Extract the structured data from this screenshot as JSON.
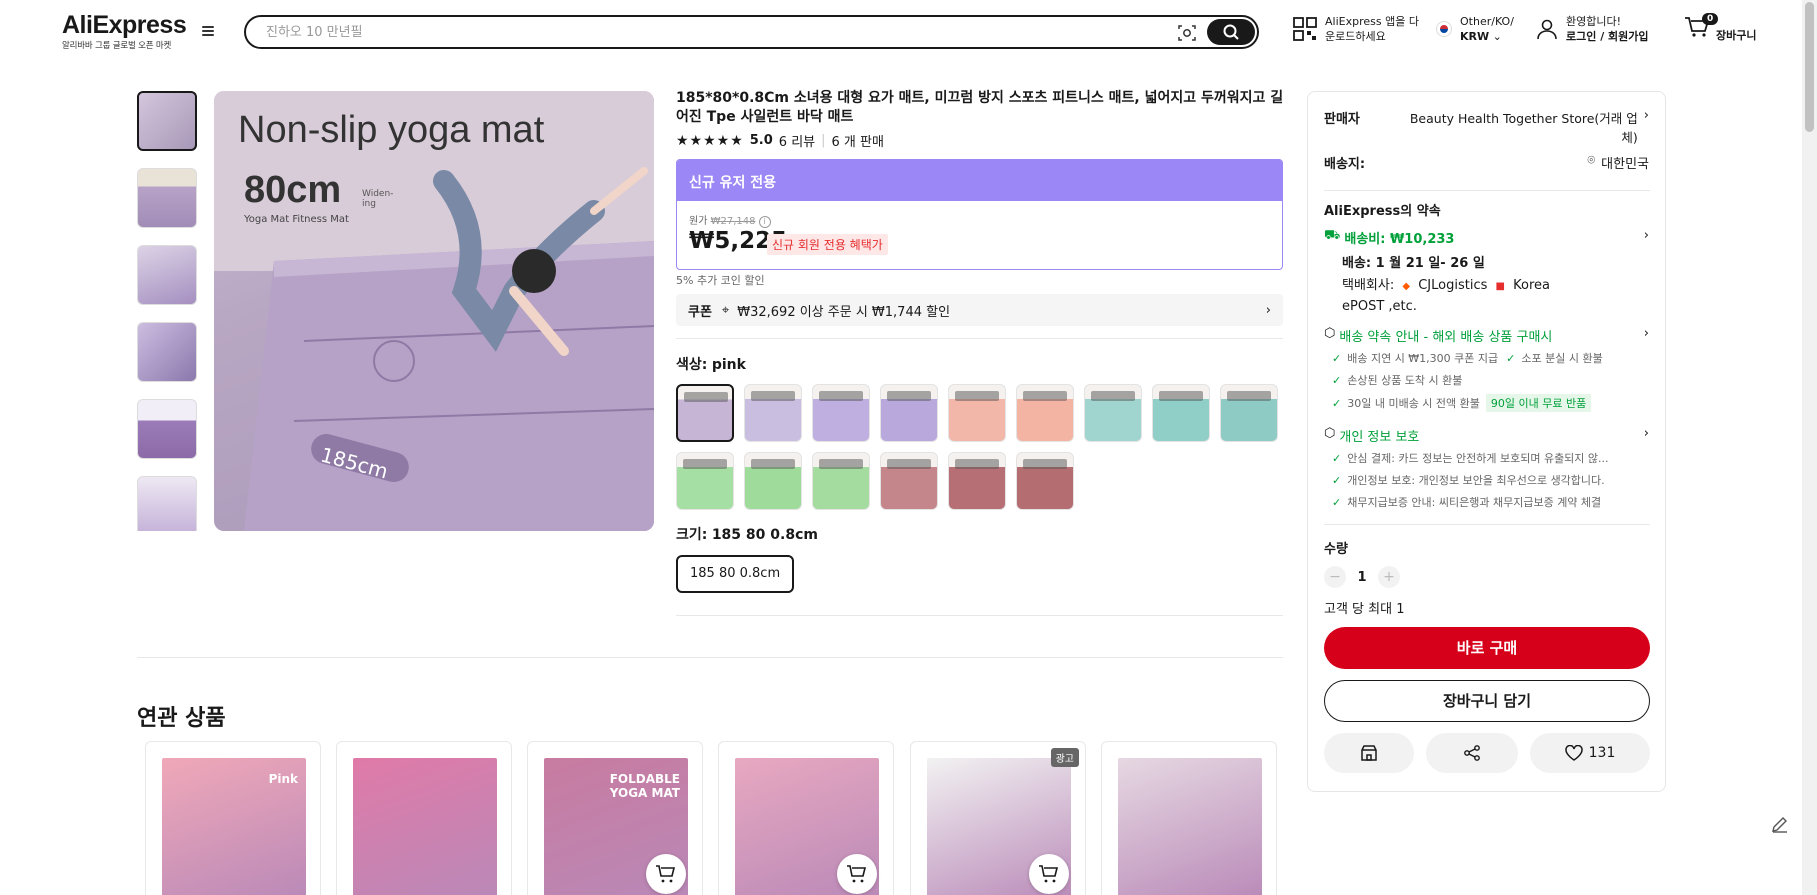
{
  "header": {
    "logo": "AliExpress",
    "logo_sub": "알리바바 그룹 글로벌 오픈 마켓",
    "search_placeholder": "진하오 10 만년필",
    "app_line1": "AliExpress 앱을 다",
    "app_line2": "운로드하세요",
    "region_line1": "Other/KO/",
    "region_line2": "KRW",
    "welcome": "환영합니다!",
    "login": "로그인 / 회원가입",
    "cart_count": "0",
    "cart_label": "장바구니"
  },
  "gallery": {
    "main_overlay_title": "Non-slip yoga mat",
    "main_overlay_size": "80cm",
    "main_overlay_widen": "Widen-ing",
    "main_overlay_sub": "Yoga Mat Fitness Mat",
    "main_overlay_length": "185cm",
    "thumb_count": 6
  },
  "product": {
    "title": "185*80*0.8Cm 소녀용 대형 요가 매트, 미끄럼 방지 스포츠 피트니스 매트, 넓어지고 두꺼워지고 길어진 Tpe 사일런트 바닥 매트",
    "rating": "5.0",
    "reviews": "6 리뷰",
    "sold": "6 개 판매",
    "promo_header": "신규 유저 전용",
    "orig_label": "원가",
    "orig_price": "₩27,148",
    "price": "₩5,225",
    "new_member_tag": "신규 회원 전용 혜택가",
    "coin_discount": "5% 추가 코인 할인",
    "coupon_label": "쿠폰",
    "coupon_text": "₩32,692 이상 주문 시 ₩1,744 할인",
    "color_label": "색상:",
    "color_value": "pink",
    "size_label": "크기:",
    "size_value": "185 80 0.8cm",
    "size_option": "185 80 0.8cm"
  },
  "swatches": [
    {
      "color": "#c7b5d6",
      "active": true
    },
    {
      "color": "#c9bde0"
    },
    {
      "color": "#bfaee0"
    },
    {
      "color": "#b9a8dc"
    },
    {
      "color": "#f2b7a8"
    },
    {
      "color": "#f4b4a4"
    },
    {
      "color": "#9fd4cf"
    },
    {
      "color": "#8fcfc8"
    },
    {
      "color": "#8ecbc4"
    },
    {
      "color": "#a6dfa4"
    },
    {
      "color": "#9fdc9b"
    },
    {
      "color": "#a4dca0"
    },
    {
      "color": "#c4868a"
    },
    {
      "color": "#b67075"
    },
    {
      "color": "#b46e72"
    }
  ],
  "panel": {
    "seller_label": "판매자",
    "seller_name": "Beauty Health Together Store(거래 업체)",
    "shipto_label": "배송지:",
    "shipto_value": "대한민국",
    "promise_title": "AliExpress의 약속",
    "shipping_fee": "배송비: ₩10,233",
    "delivery": "배송: 1 월 21 일- 26 일",
    "carrier_label": "택배회사:",
    "carrier1": "CJLogistics",
    "carrier2": "Korea",
    "carrier3": "ePOST ,etc.",
    "promise_link": "배송 약속 안내 - 해외 배송 상품 구매시",
    "promise_items": [
      "배송 지연 시 ₩1,300 쿠폰 지급",
      "소포 분실 시 환불",
      "손상된 상품 도착 시 환불",
      "30일 내 미배송 시 전액 환불"
    ],
    "free_return": "90일 이내 무료 반품",
    "privacy_title": "개인 정보 보호",
    "privacy_items": [
      "안심 결제: 카드 정보는 안전하게 보호되며 유출되지 않...",
      "개인정보 보호: 개인정보 보안을 최우선으로 생각합니다.",
      "채무지급보증 안내: 씨티은행과 채무지급보증 계약 체결"
    ],
    "qty_label": "수량",
    "qty_value": "1",
    "qty_limit": "고객 당 최대 1",
    "buy_now": "바로 구매",
    "add_cart": "장바구니 담기",
    "wishlist_count": "131"
  },
  "related": {
    "title": "연관 상품",
    "ad_label": "광고",
    "cards": [
      {
        "bg": "#f0a8b8",
        "text": "Pink"
      },
      {
        "bg": "#e07aa8",
        "text": ""
      },
      {
        "bg": "#c87ba0",
        "text": "FOLDABLE YOGA MAT"
      },
      {
        "bg": "#e8a8c0",
        "text": ""
      },
      {
        "bg": "#f2f2f2",
        "text": ""
      },
      {
        "bg": "#e6d8e2",
        "text": ""
      }
    ]
  }
}
